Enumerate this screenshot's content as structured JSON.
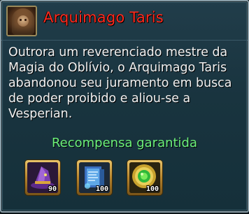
{
  "npc": {
    "name": "Arquimago Taris",
    "portrait_icon": "hooded-mage-portrait-icon"
  },
  "description": "Outrora um reverenciado mestre da Magia do Oblívio, o Arquimago Taris abandonou seu juramento em busca de poder proibido e aliou-se a Vesperian.",
  "rewards": {
    "title": "Recompensa garantida",
    "items": [
      {
        "icon": "wizard-hat-icon",
        "quantity": "90"
      },
      {
        "icon": "spell-scroll-icon",
        "quantity": "100"
      },
      {
        "icon": "green-orb-coin-icon",
        "quantity": "100"
      }
    ]
  },
  "colors": {
    "title": "#ff2a1e",
    "section_heading": "#6cf07a",
    "body_text": "#f2f2f2",
    "panel_bg": "#19343f"
  }
}
